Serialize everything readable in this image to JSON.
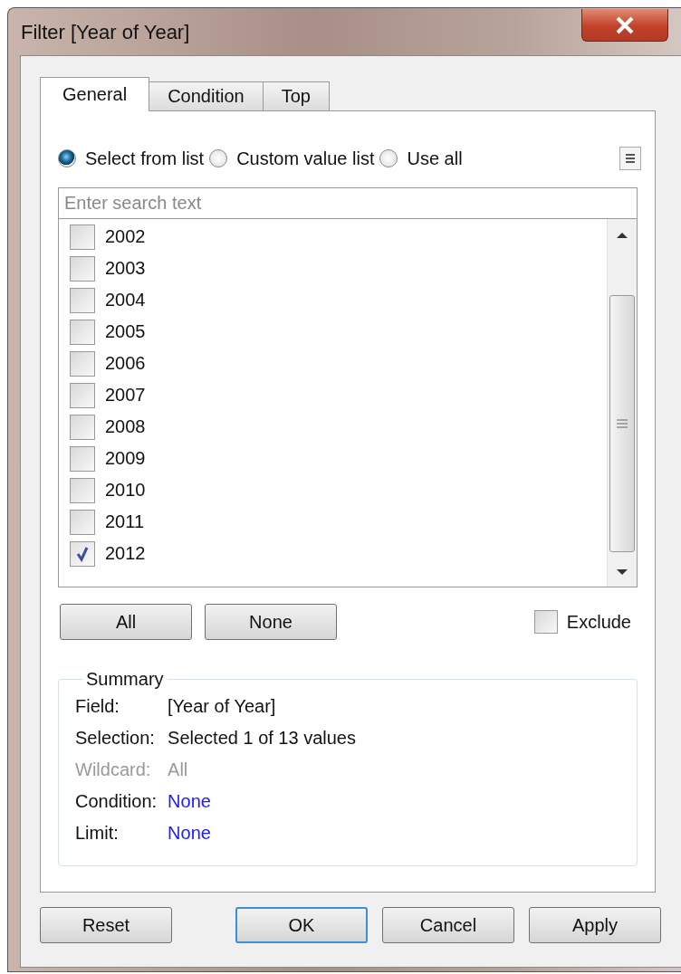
{
  "window": {
    "title": "Filter [Year of Year]"
  },
  "tabs": [
    {
      "label": "General",
      "selected": true
    },
    {
      "label": "Condition",
      "selected": false
    },
    {
      "label": "Top",
      "selected": false
    }
  ],
  "mode_options": [
    {
      "label": "Select from list",
      "selected": true
    },
    {
      "label": "Custom value list",
      "selected": false
    },
    {
      "label": "Use all",
      "selected": false
    }
  ],
  "search": {
    "placeholder": "Enter search text"
  },
  "values": [
    {
      "label": "2002",
      "checked": false
    },
    {
      "label": "2003",
      "checked": false
    },
    {
      "label": "2004",
      "checked": false
    },
    {
      "label": "2005",
      "checked": false
    },
    {
      "label": "2006",
      "checked": false
    },
    {
      "label": "2007",
      "checked": false
    },
    {
      "label": "2008",
      "checked": false
    },
    {
      "label": "2009",
      "checked": false
    },
    {
      "label": "2010",
      "checked": false
    },
    {
      "label": "2011",
      "checked": false
    },
    {
      "label": "2012",
      "checked": true
    }
  ],
  "list_buttons": [
    "All",
    "None"
  ],
  "exclude": {
    "label": "Exclude",
    "checked": false
  },
  "summary": {
    "title": "Summary",
    "rows": [
      {
        "label": "Field:",
        "value": "[Year of Year]",
        "disabled": false,
        "kind": "text"
      },
      {
        "label": "Selection:",
        "value": "Selected 1 of 13 values",
        "disabled": false,
        "kind": "text"
      },
      {
        "label": "Wildcard:",
        "value": "All",
        "disabled": true,
        "kind": "text"
      },
      {
        "label": "Condition:",
        "value": "None",
        "disabled": false,
        "kind": "link"
      },
      {
        "label": "Limit:",
        "value": "None",
        "disabled": false,
        "kind": "link"
      }
    ]
  },
  "buttons": [
    {
      "label": "Reset",
      "default": false
    },
    {
      "label": "OK",
      "default": true
    },
    {
      "label": "Cancel",
      "default": false
    },
    {
      "label": "Apply",
      "default": false
    }
  ]
}
